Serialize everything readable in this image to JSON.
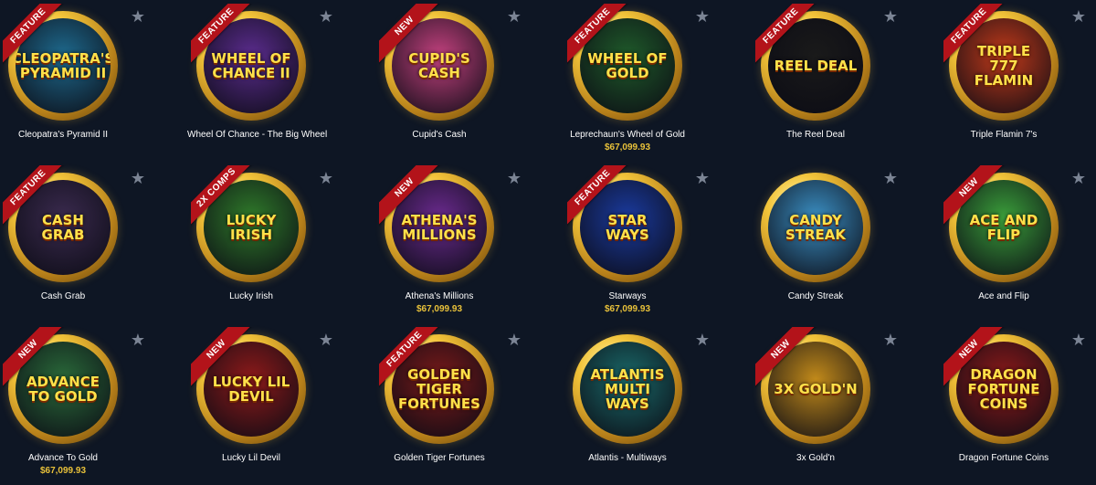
{
  "games": [
    {
      "name": "Cleopatra's Pyramid II",
      "art": "Cleopatra's Pyramid II",
      "badge": "FEATURE",
      "jackpot": "",
      "bg": "#1e6a8e"
    },
    {
      "name": "Wheel Of Chance - The Big Wheel",
      "art": "Wheel of Chance II",
      "badge": "FEATURE",
      "jackpot": "",
      "bg": "#5b2c8e"
    },
    {
      "name": "Cupid's Cash",
      "art": "Cupid's Cash",
      "badge": "NEW",
      "jackpot": "",
      "bg": "#c2417e"
    },
    {
      "name": "Leprechaun's Wheel of Gold",
      "art": "Wheel of Gold",
      "badge": "FEATURE",
      "jackpot": "$67,099.93",
      "bg": "#1f5a2a"
    },
    {
      "name": "The Reel Deal",
      "art": "Reel Deal",
      "badge": "FEATURE",
      "jackpot": "",
      "bg": "#1a1a1a"
    },
    {
      "name": "Triple Flamin 7's",
      "art": "Triple 777 Flamin",
      "badge": "FEATURE",
      "jackpot": "",
      "bg": "#c23a1a"
    },
    {
      "name": "Cash Grab",
      "art": "Cash Grab",
      "badge": "FEATURE",
      "jackpot": "",
      "bg": "#3a2a4e"
    },
    {
      "name": "Lucky Irish",
      "art": "Lucky Irish",
      "badge": "2X COMPS",
      "jackpot": "",
      "bg": "#2f7a2a"
    },
    {
      "name": "Athena's Millions",
      "art": "Athena's Millions",
      "badge": "NEW",
      "jackpot": "$67,099.93",
      "bg": "#6a2a8e"
    },
    {
      "name": "Starways",
      "art": "Star Ways",
      "badge": "FEATURE",
      "jackpot": "$67,099.93",
      "bg": "#1a3a9e"
    },
    {
      "name": "Candy Streak",
      "art": "Candy Streak",
      "badge": "",
      "jackpot": "",
      "bg": "#3a8ec2"
    },
    {
      "name": "Ace and Flip",
      "art": "Ace and Flip",
      "badge": "NEW",
      "jackpot": "",
      "bg": "#3a9e3a"
    },
    {
      "name": "Advance To Gold",
      "art": "Advance To Gold",
      "badge": "NEW",
      "jackpot": "$67,099.93",
      "bg": "#2a6a3a"
    },
    {
      "name": "Lucky Lil Devil",
      "art": "Lucky Lil Devil",
      "badge": "NEW",
      "jackpot": "",
      "bg": "#8e1a1a"
    },
    {
      "name": "Golden Tiger Fortunes",
      "art": "Golden Tiger Fortunes",
      "badge": "FEATURE",
      "jackpot": "",
      "bg": "#7a1a1a"
    },
    {
      "name": "Atlantis - Multiways",
      "art": "Atlantis Multi Ways",
      "badge": "",
      "jackpot": "",
      "bg": "#1a6a6a"
    },
    {
      "name": "3x Gold'n",
      "art": "3X Gold'n",
      "badge": "NEW",
      "jackpot": "",
      "bg": "#c28a1a"
    },
    {
      "name": "Dragon Fortune Coins",
      "art": "Dragon Fortune Coins",
      "badge": "NEW",
      "jackpot": "",
      "bg": "#8e1a1a"
    }
  ],
  "icons": {
    "favorite": "star-icon",
    "favorite_glyph": "★"
  },
  "colors": {
    "background": "#0e1624",
    "jackpot": "#e8c13a",
    "ribbon": "#b3131a",
    "star": "#7b8494"
  }
}
